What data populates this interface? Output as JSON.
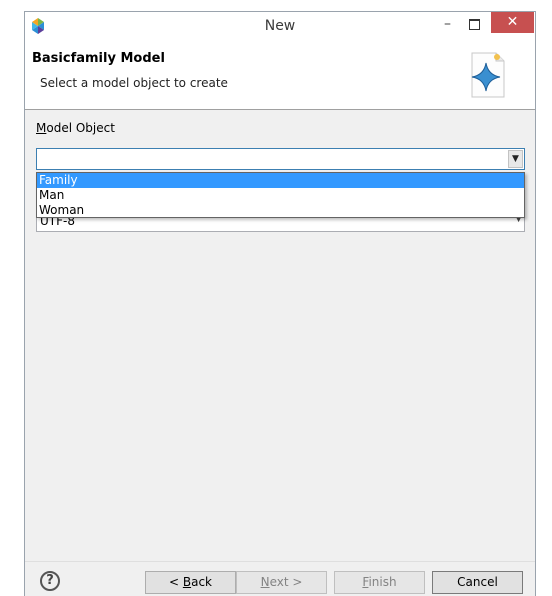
{
  "window": {
    "title": "New"
  },
  "titlebar": {
    "minimize": "–",
    "close": "✕"
  },
  "header": {
    "title": "Basicfamily Model",
    "description": "Select a model object to create"
  },
  "form": {
    "model_object_label_mnemonic": "M",
    "model_object_label_rest": "odel Object",
    "model_object_value": "",
    "dropdown_options": [
      "Family",
      "Man",
      "Woman"
    ],
    "selected_option": "Family",
    "encoding_value": "UTF-8"
  },
  "buttons": {
    "help": "?",
    "back_prefix": "< ",
    "back_mnemonic": "B",
    "back_rest": "ack",
    "next_mnemonic": "N",
    "next_rest": "ext >",
    "finish_mnemonic": "F",
    "finish_rest": "inish",
    "cancel": "Cancel"
  },
  "colors": {
    "selection": "#3399ff",
    "close_button": "#c75050",
    "focus_border": "#3c7fb1"
  }
}
